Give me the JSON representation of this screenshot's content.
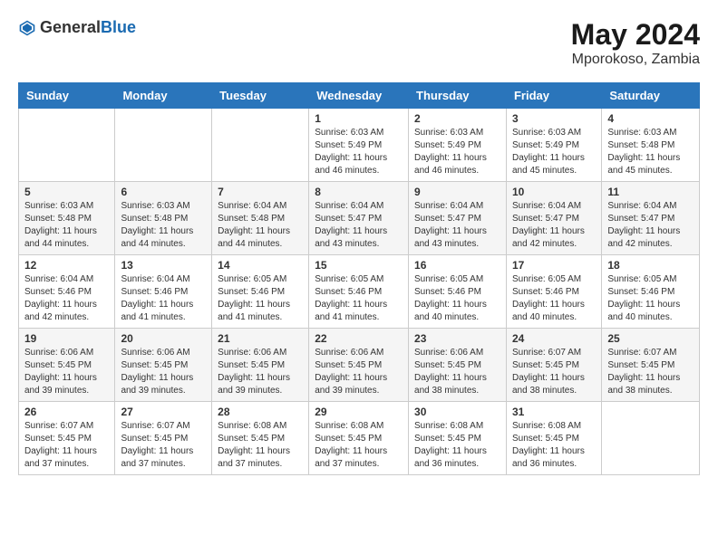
{
  "header": {
    "logo_general": "General",
    "logo_blue": "Blue",
    "month": "May 2024",
    "location": "Mporokoso, Zambia"
  },
  "days_of_week": [
    "Sunday",
    "Monday",
    "Tuesday",
    "Wednesday",
    "Thursday",
    "Friday",
    "Saturday"
  ],
  "weeks": [
    [
      {
        "day": "",
        "info": ""
      },
      {
        "day": "",
        "info": ""
      },
      {
        "day": "",
        "info": ""
      },
      {
        "day": "1",
        "info": "Sunrise: 6:03 AM\nSunset: 5:49 PM\nDaylight: 11 hours\nand 46 minutes."
      },
      {
        "day": "2",
        "info": "Sunrise: 6:03 AM\nSunset: 5:49 PM\nDaylight: 11 hours\nand 46 minutes."
      },
      {
        "day": "3",
        "info": "Sunrise: 6:03 AM\nSunset: 5:49 PM\nDaylight: 11 hours\nand 45 minutes."
      },
      {
        "day": "4",
        "info": "Sunrise: 6:03 AM\nSunset: 5:48 PM\nDaylight: 11 hours\nand 45 minutes."
      }
    ],
    [
      {
        "day": "5",
        "info": "Sunrise: 6:03 AM\nSunset: 5:48 PM\nDaylight: 11 hours\nand 44 minutes."
      },
      {
        "day": "6",
        "info": "Sunrise: 6:03 AM\nSunset: 5:48 PM\nDaylight: 11 hours\nand 44 minutes."
      },
      {
        "day": "7",
        "info": "Sunrise: 6:04 AM\nSunset: 5:48 PM\nDaylight: 11 hours\nand 44 minutes."
      },
      {
        "day": "8",
        "info": "Sunrise: 6:04 AM\nSunset: 5:47 PM\nDaylight: 11 hours\nand 43 minutes."
      },
      {
        "day": "9",
        "info": "Sunrise: 6:04 AM\nSunset: 5:47 PM\nDaylight: 11 hours\nand 43 minutes."
      },
      {
        "day": "10",
        "info": "Sunrise: 6:04 AM\nSunset: 5:47 PM\nDaylight: 11 hours\nand 42 minutes."
      },
      {
        "day": "11",
        "info": "Sunrise: 6:04 AM\nSunset: 5:47 PM\nDaylight: 11 hours\nand 42 minutes."
      }
    ],
    [
      {
        "day": "12",
        "info": "Sunrise: 6:04 AM\nSunset: 5:46 PM\nDaylight: 11 hours\nand 42 minutes."
      },
      {
        "day": "13",
        "info": "Sunrise: 6:04 AM\nSunset: 5:46 PM\nDaylight: 11 hours\nand 41 minutes."
      },
      {
        "day": "14",
        "info": "Sunrise: 6:05 AM\nSunset: 5:46 PM\nDaylight: 11 hours\nand 41 minutes."
      },
      {
        "day": "15",
        "info": "Sunrise: 6:05 AM\nSunset: 5:46 PM\nDaylight: 11 hours\nand 41 minutes."
      },
      {
        "day": "16",
        "info": "Sunrise: 6:05 AM\nSunset: 5:46 PM\nDaylight: 11 hours\nand 40 minutes."
      },
      {
        "day": "17",
        "info": "Sunrise: 6:05 AM\nSunset: 5:46 PM\nDaylight: 11 hours\nand 40 minutes."
      },
      {
        "day": "18",
        "info": "Sunrise: 6:05 AM\nSunset: 5:46 PM\nDaylight: 11 hours\nand 40 minutes."
      }
    ],
    [
      {
        "day": "19",
        "info": "Sunrise: 6:06 AM\nSunset: 5:45 PM\nDaylight: 11 hours\nand 39 minutes."
      },
      {
        "day": "20",
        "info": "Sunrise: 6:06 AM\nSunset: 5:45 PM\nDaylight: 11 hours\nand 39 minutes."
      },
      {
        "day": "21",
        "info": "Sunrise: 6:06 AM\nSunset: 5:45 PM\nDaylight: 11 hours\nand 39 minutes."
      },
      {
        "day": "22",
        "info": "Sunrise: 6:06 AM\nSunset: 5:45 PM\nDaylight: 11 hours\nand 39 minutes."
      },
      {
        "day": "23",
        "info": "Sunrise: 6:06 AM\nSunset: 5:45 PM\nDaylight: 11 hours\nand 38 minutes."
      },
      {
        "day": "24",
        "info": "Sunrise: 6:07 AM\nSunset: 5:45 PM\nDaylight: 11 hours\nand 38 minutes."
      },
      {
        "day": "25",
        "info": "Sunrise: 6:07 AM\nSunset: 5:45 PM\nDaylight: 11 hours\nand 38 minutes."
      }
    ],
    [
      {
        "day": "26",
        "info": "Sunrise: 6:07 AM\nSunset: 5:45 PM\nDaylight: 11 hours\nand 37 minutes."
      },
      {
        "day": "27",
        "info": "Sunrise: 6:07 AM\nSunset: 5:45 PM\nDaylight: 11 hours\nand 37 minutes."
      },
      {
        "day": "28",
        "info": "Sunrise: 6:08 AM\nSunset: 5:45 PM\nDaylight: 11 hours\nand 37 minutes."
      },
      {
        "day": "29",
        "info": "Sunrise: 6:08 AM\nSunset: 5:45 PM\nDaylight: 11 hours\nand 37 minutes."
      },
      {
        "day": "30",
        "info": "Sunrise: 6:08 AM\nSunset: 5:45 PM\nDaylight: 11 hours\nand 36 minutes."
      },
      {
        "day": "31",
        "info": "Sunrise: 6:08 AM\nSunset: 5:45 PM\nDaylight: 11 hours\nand 36 minutes."
      },
      {
        "day": "",
        "info": ""
      }
    ]
  ]
}
